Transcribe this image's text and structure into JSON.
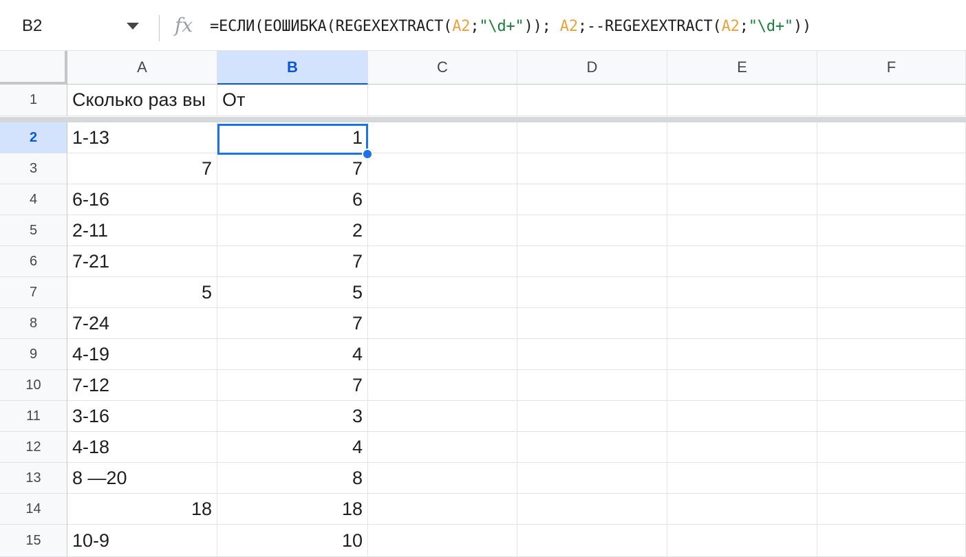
{
  "formula_bar": {
    "name_box": "B2",
    "fx_label": "fx",
    "formula": {
      "p1": "=ЕСЛИ(ЕОШИБКА(REGEXEXTRACT(",
      "ref1": "A2",
      "p2": ";",
      "str1": "\"\\d+\"",
      "p3": ")); ",
      "ref2": "A2",
      "p4": ";--REGEXEXTRACT(",
      "ref3": "A2",
      "p5": ";",
      "str2": "\"\\d+\"",
      "p6": "))"
    }
  },
  "columns": [
    "A",
    "B",
    "C",
    "D",
    "E",
    "F"
  ],
  "rows": [
    {
      "num": "1",
      "a": "Сколько раз вы",
      "b": "От"
    },
    {
      "num": "2",
      "a": "1-13",
      "b": "1"
    },
    {
      "num": "3",
      "a": "7",
      "b": "7"
    },
    {
      "num": "4",
      "a": "6-16",
      "b": "6"
    },
    {
      "num": "5",
      "a": "2-11",
      "b": "2"
    },
    {
      "num": "6",
      "a": "7-21",
      "b": "7"
    },
    {
      "num": "7",
      "a": "5",
      "b": "5"
    },
    {
      "num": "8",
      "a": "7-24",
      "b": "7"
    },
    {
      "num": "9",
      "a": "4-19",
      "b": "4"
    },
    {
      "num": "10",
      "a": "7-12",
      "b": "7"
    },
    {
      "num": "11",
      "a": "3-16",
      "b": "3"
    },
    {
      "num": "12",
      "a": "4-18",
      "b": "4"
    },
    {
      "num": "13",
      "a": "8  —20",
      "b": "8"
    },
    {
      "num": "14",
      "a": "18",
      "b": "18"
    },
    {
      "num": "15",
      "a": "10-9",
      "b": "10"
    }
  ],
  "selection": {
    "cell": "B2"
  },
  "colors": {
    "accent": "#1a73e8",
    "header_active_bg": "#d3e3fd",
    "ref": "#e8a33d",
    "string": "#188038"
  }
}
